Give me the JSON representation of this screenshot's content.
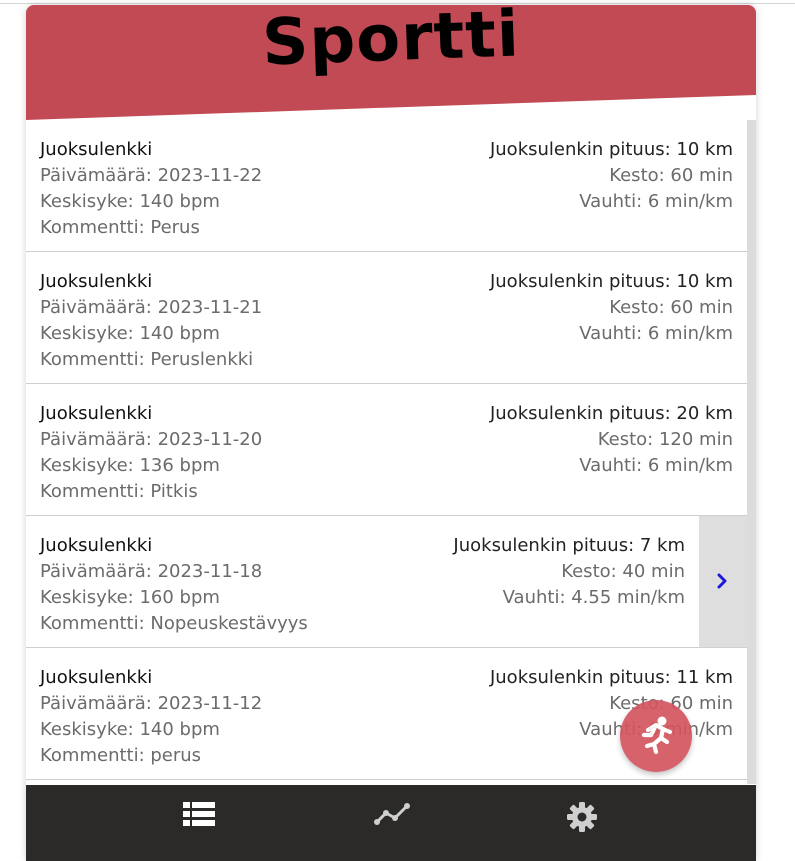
{
  "app": {
    "title": "Sportti",
    "brand_color": "#c24a55",
    "nav_color": "#2b2a28",
    "fab_color": "#d35560"
  },
  "runs": [
    {
      "type": "Juoksulenkki",
      "date": "Päivämäärä: 2023-11-22",
      "heart_rate": "Keskisyke: 140 bpm",
      "comment": "Kommentti: Perus",
      "distance": "Juoksulenkin pituus: 10 km",
      "duration": "Kesto: 60 min",
      "pace": "Vauhti: 6 min/km"
    },
    {
      "type": "Juoksulenkki",
      "date": "Päivämäärä: 2023-11-21",
      "heart_rate": "Keskisyke: 140 bpm",
      "comment": "Kommentti: Peruslenkki",
      "distance": "Juoksulenkin pituus: 10 km",
      "duration": "Kesto: 60 min",
      "pace": "Vauhti: 6 min/km"
    },
    {
      "type": "Juoksulenkki",
      "date": "Päivämäärä: 2023-11-20",
      "heart_rate": "Keskisyke: 136 bpm",
      "comment": "Kommentti: Pitkis",
      "distance": "Juoksulenkin pituus: 20 km",
      "duration": "Kesto: 120 min",
      "pace": "Vauhti: 6 min/km"
    },
    {
      "type": "Juoksulenkki",
      "date": "Päivämäärä: 2023-11-18",
      "heart_rate": "Keskisyke: 160 bpm",
      "comment": "Kommentti: Nopeuskestävyys",
      "distance": "Juoksulenkin pituus: 7 km",
      "duration": "Kesto: 40 min",
      "pace": "Vauhti: 4.55 min/km"
    },
    {
      "type": "Juoksulenkki",
      "date": "Päivämäärä: 2023-11-12",
      "heart_rate": "Keskisyke: 140 bpm",
      "comment": "Kommentti: perus",
      "distance": "Juoksulenkin pituus: 11 km",
      "duration": "Kesto: 60 min",
      "pace": "Vauhti: 6 min/km"
    }
  ],
  "swipe": {
    "open_row": 3,
    "icon": "chevron-right-icon",
    "icon_color": "#1a1adb"
  },
  "fab": {
    "icon": "running-person-icon"
  },
  "bottom_nav": [
    {
      "icon": "list-icon"
    },
    {
      "icon": "trend-line-icon"
    },
    {
      "icon": "gear-icon"
    }
  ]
}
